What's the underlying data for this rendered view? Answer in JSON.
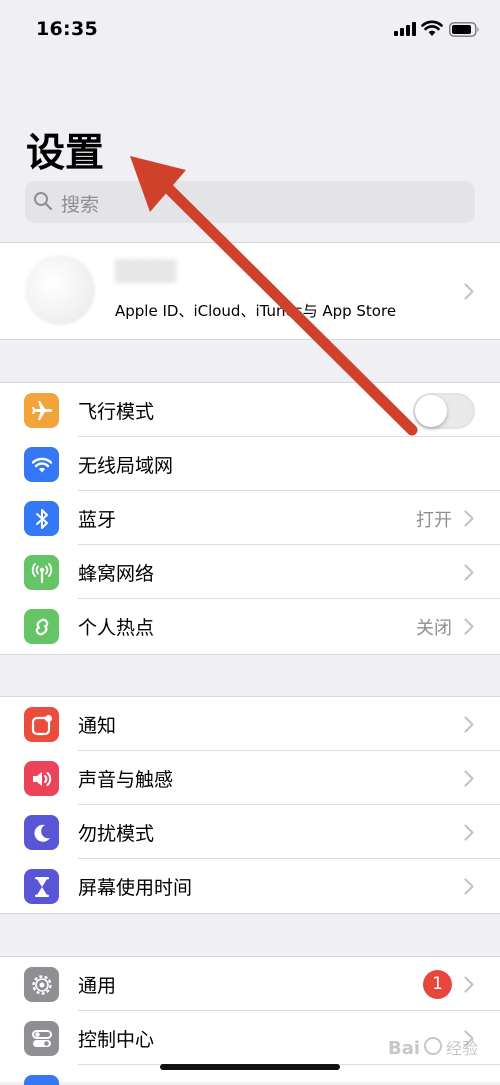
{
  "status_bar": {
    "time": "16:35"
  },
  "header": {
    "title": "设置",
    "search_placeholder": "搜索"
  },
  "profile": {
    "subtitle": "Apple ID、iCloud、iTunes与 App Store"
  },
  "group1": {
    "airplane": {
      "label": "飞行模式",
      "toggle_on": false,
      "icon": "airplane-icon",
      "color": "#f2a33a"
    },
    "wifi": {
      "label": "无线局域网",
      "icon": "wifi-icon",
      "color": "#3478f6"
    },
    "bluetooth": {
      "label": "蓝牙",
      "value": "打开",
      "icon": "bluetooth-icon",
      "color": "#3478f6"
    },
    "cellular": {
      "label": "蜂窝网络",
      "icon": "cellular-antenna-icon",
      "color": "#65c466"
    },
    "hotspot": {
      "label": "个人热点",
      "value": "关闭",
      "icon": "hotspot-link-icon",
      "color": "#65c466"
    }
  },
  "group2": {
    "notifications": {
      "label": "通知",
      "icon": "notifications-icon",
      "color": "#eb4d3d"
    },
    "sounds": {
      "label": "声音与触感",
      "icon": "speaker-icon",
      "color": "#eb445a"
    },
    "dnd": {
      "label": "勿扰模式",
      "icon": "moon-icon",
      "color": "#5856d6"
    },
    "screen_time": {
      "label": "屏幕使用时间",
      "icon": "hourglass-icon",
      "color": "#5856d6"
    }
  },
  "group3": {
    "general": {
      "label": "通用",
      "badge": "1",
      "icon": "gear-icon",
      "color": "#8e8e93"
    },
    "control_center": {
      "label": "控制中心",
      "icon": "control-switches-icon",
      "color": "#8e8e93"
    }
  },
  "annotation": {
    "color": "#d0412c"
  },
  "watermark": {
    "text": "Bai 经验"
  }
}
